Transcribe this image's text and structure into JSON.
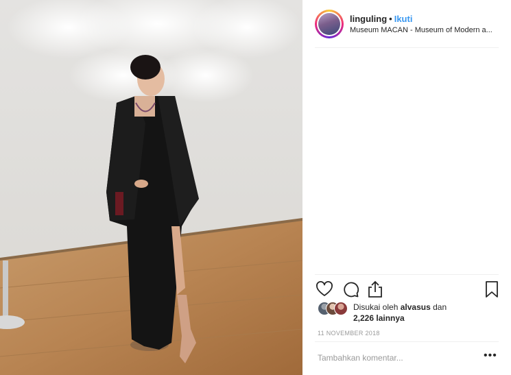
{
  "post": {
    "username": "linguling",
    "separator": "•",
    "follow_label": "Ikuti",
    "location": "Museum MACAN - Museum of Modern a...",
    "liked_by_prefix": "Disukai oleh",
    "liked_by_user": "alvasus",
    "liked_by_conj": "dan",
    "liked_others": "2,226 lainnya",
    "date": "11 NOVEMBER 2018",
    "comment_placeholder": "Tambahkan komentar...",
    "more_label": "•••"
  },
  "icons": {
    "like": "heart-icon",
    "comment": "comment-icon",
    "share": "share-icon",
    "save": "bookmark-icon",
    "more": "more-options-icon"
  },
  "colors": {
    "follow": "#3897f0",
    "text": "#262626",
    "muted": "#999999",
    "divider": "#efefef"
  }
}
